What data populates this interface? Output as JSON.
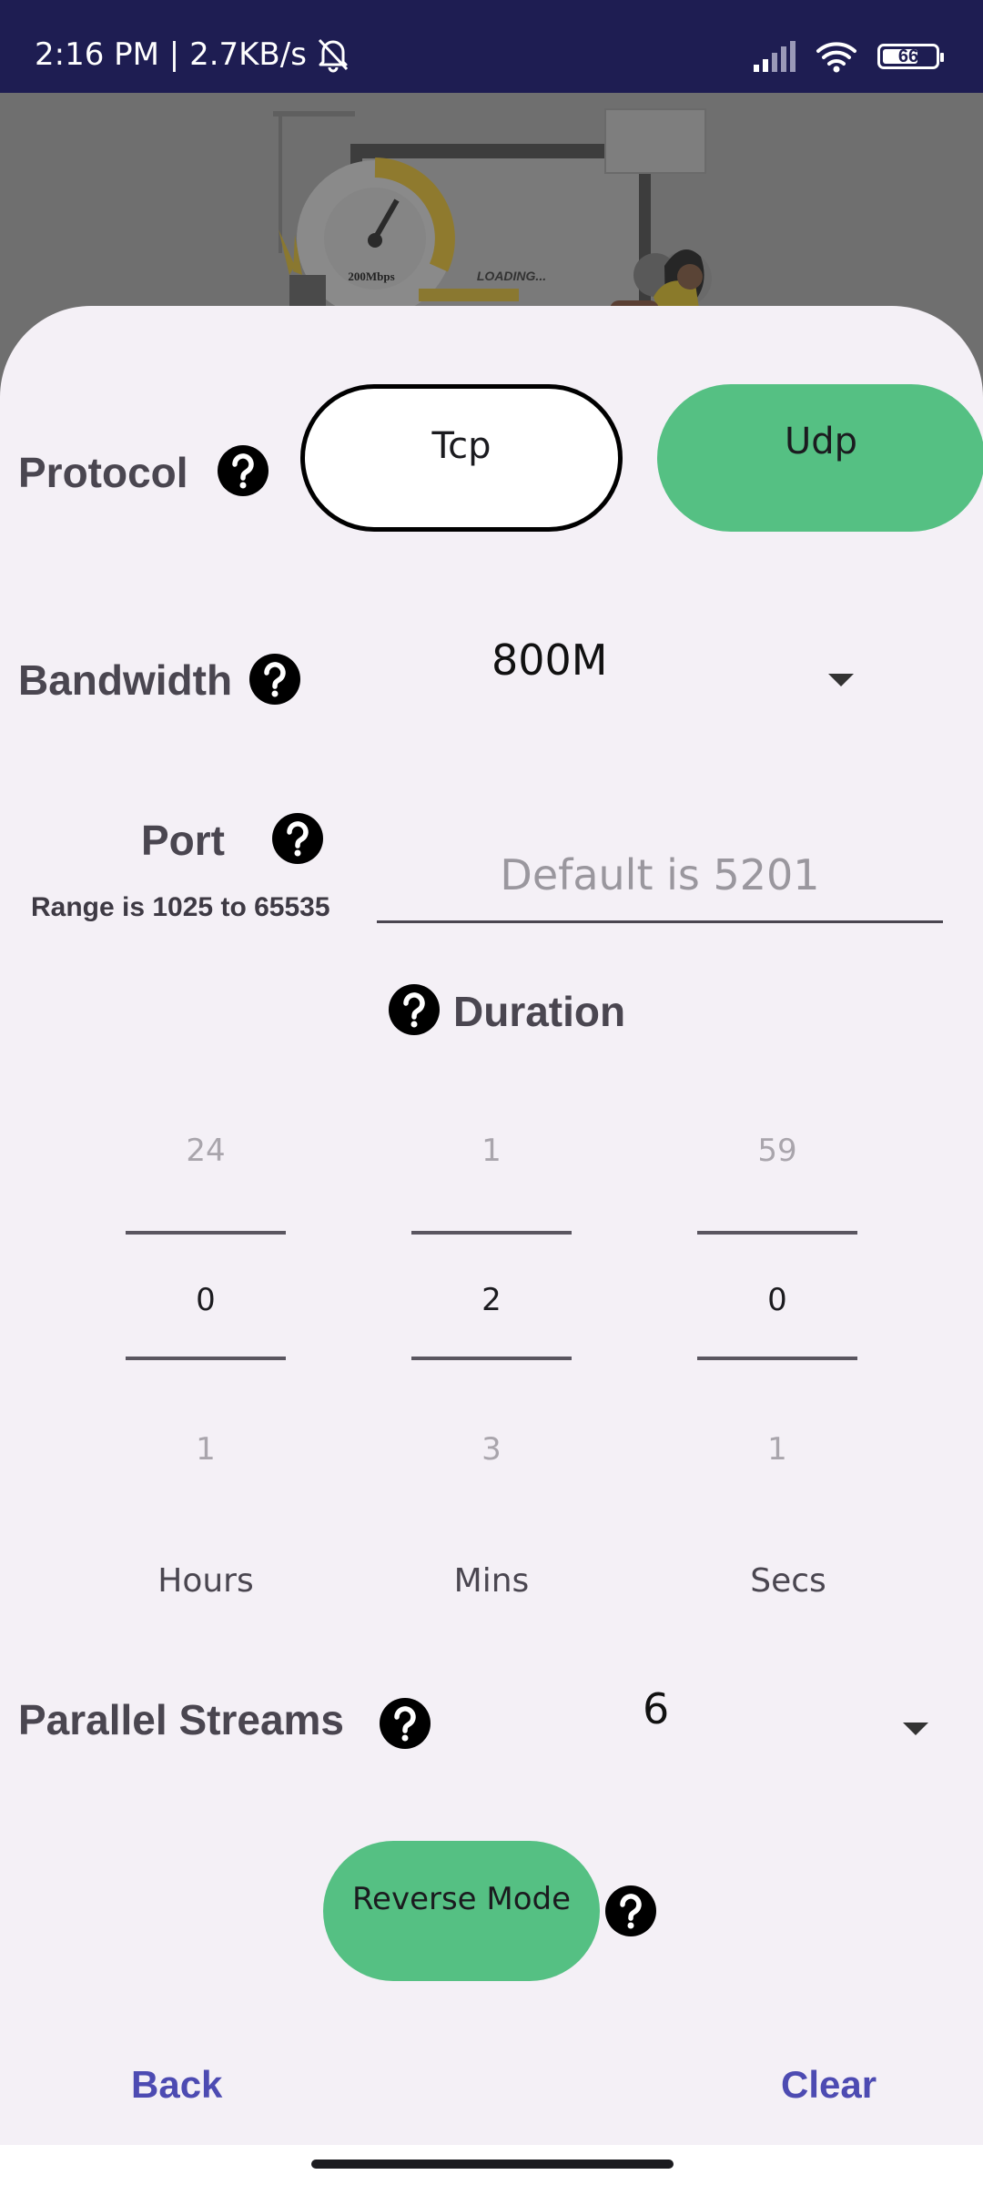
{
  "status_bar": {
    "time_speed": "2:16 PM | 2.7KB/s",
    "battery_level": "66"
  },
  "illustration": {
    "gauge_text": "200Mbps",
    "loading_text": "LOADING..."
  },
  "protocol": {
    "label": "Protocol",
    "options": [
      "Tcp",
      "Udp"
    ],
    "selected": "Udp"
  },
  "bandwidth": {
    "label": "Bandwidth",
    "value": "800M"
  },
  "port": {
    "label": "Port",
    "range_note": "Range is 1025 to 65535",
    "placeholder": "Default is 5201"
  },
  "duration": {
    "label": "Duration",
    "hours": {
      "prev": "24",
      "value": "0",
      "next": "1",
      "unit": "Hours"
    },
    "mins": {
      "prev": "1",
      "value": "2",
      "next": "3",
      "unit": "Mins"
    },
    "secs": {
      "prev": "59",
      "value": "0",
      "next": "1",
      "unit": "Secs"
    }
  },
  "parallel_streams": {
    "label": "Parallel Streams",
    "value": "6"
  },
  "reverse_mode": {
    "label": "Reverse Mode"
  },
  "footer": {
    "back_label": "Back",
    "clear_label": "Clear"
  },
  "colors": {
    "status_bar": "#1e1d52",
    "accent_green": "#55c083",
    "link_blue": "#4d4bb2",
    "sheet_bg": "#f4f0f6"
  }
}
